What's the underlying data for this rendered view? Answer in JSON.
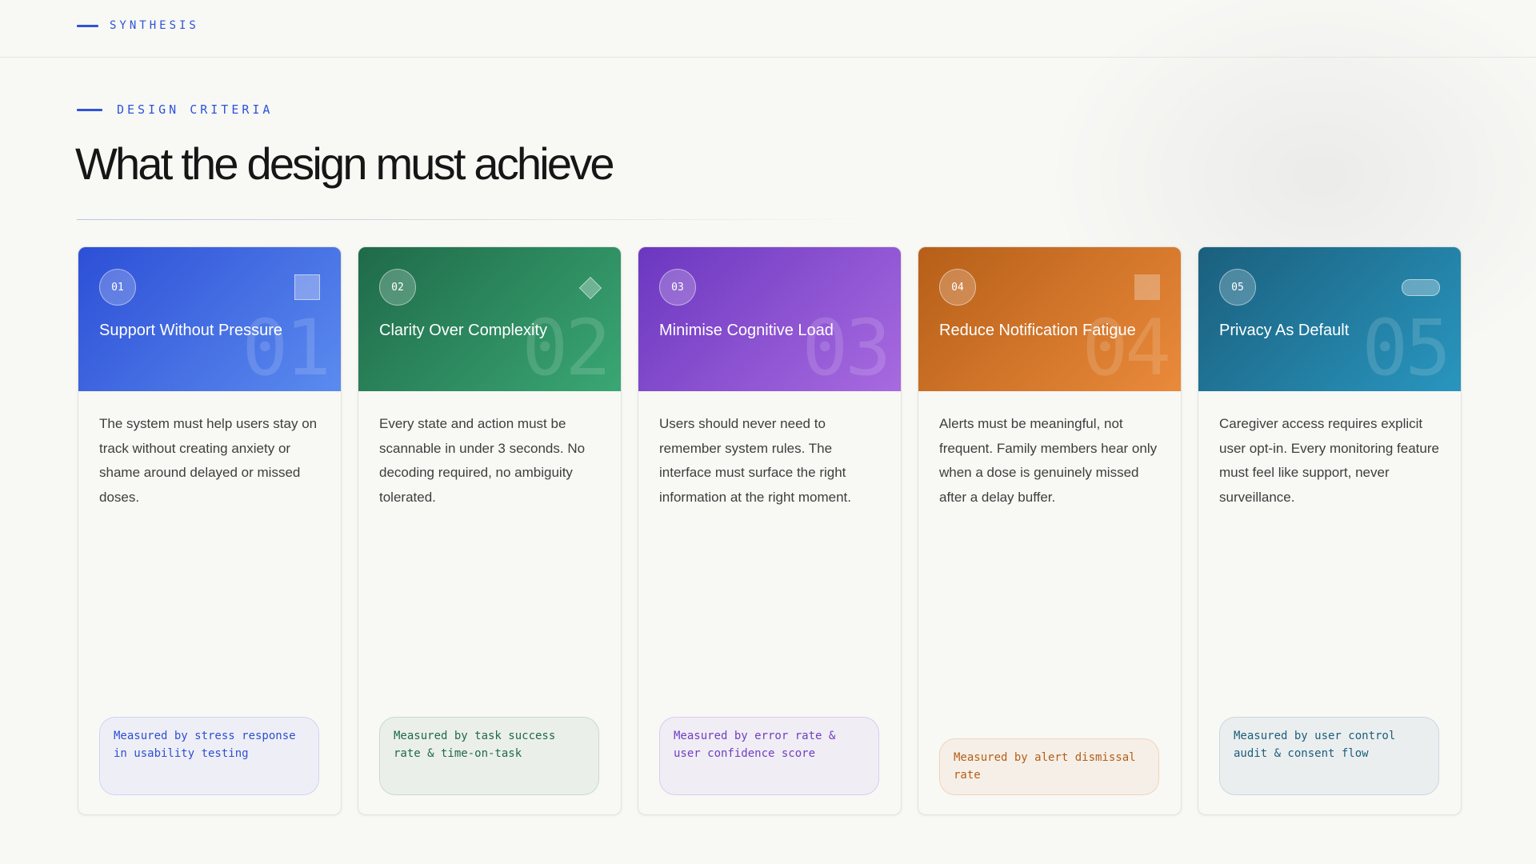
{
  "header": {
    "eyebrow": "SYNTHESIS"
  },
  "section": {
    "eyebrow": "DESIGN CRITERIA",
    "title": "What the design must achieve"
  },
  "accent_color": "#2f54d8",
  "cards": [
    {
      "number": "01",
      "title": "Support Without Pressure",
      "ghost_number": "01",
      "icon": "square-icon",
      "color": "#3b63e0",
      "description": "The system must help users stay on track without creating anxiety or shame around delayed or missed doses.",
      "metric": "Measured by stress response in usability testing"
    },
    {
      "number": "02",
      "title": "Clarity Over Complexity",
      "ghost_number": "02",
      "icon": "diamond-icon",
      "color": "#2a8a5c",
      "description": "Every state and action must be scannable in under 3 seconds. No decoding required, no ambiguity tolerated.",
      "metric": "Measured by task success rate & time-on-task"
    },
    {
      "number": "03",
      "title": "Minimise Cognitive Load",
      "ghost_number": "03",
      "icon": "",
      "color": "#8a4fd2",
      "description": "Users should never need to remember system rules. The interface must surface the right information at the right moment.",
      "metric": "Measured by error rate & user confidence score"
    },
    {
      "number": "04",
      "title": "Reduce Notification Fatigue",
      "ghost_number": "04",
      "icon": "square-icon",
      "color": "#d47428",
      "description": "Alerts must be meaningful, not frequent. Family members hear only when a dose is genuinely missed after a delay buffer.",
      "metric": "Measured by alert dismissal rate"
    },
    {
      "number": "05",
      "title": "Privacy As Default",
      "ghost_number": "05",
      "icon": "pill-icon",
      "color": "#217aa0",
      "description": "Caregiver access requires explicit user opt-in. Every monitoring feature must feel like support, never surveillance.",
      "metric": "Measured by user control audit & consent flow"
    }
  ]
}
